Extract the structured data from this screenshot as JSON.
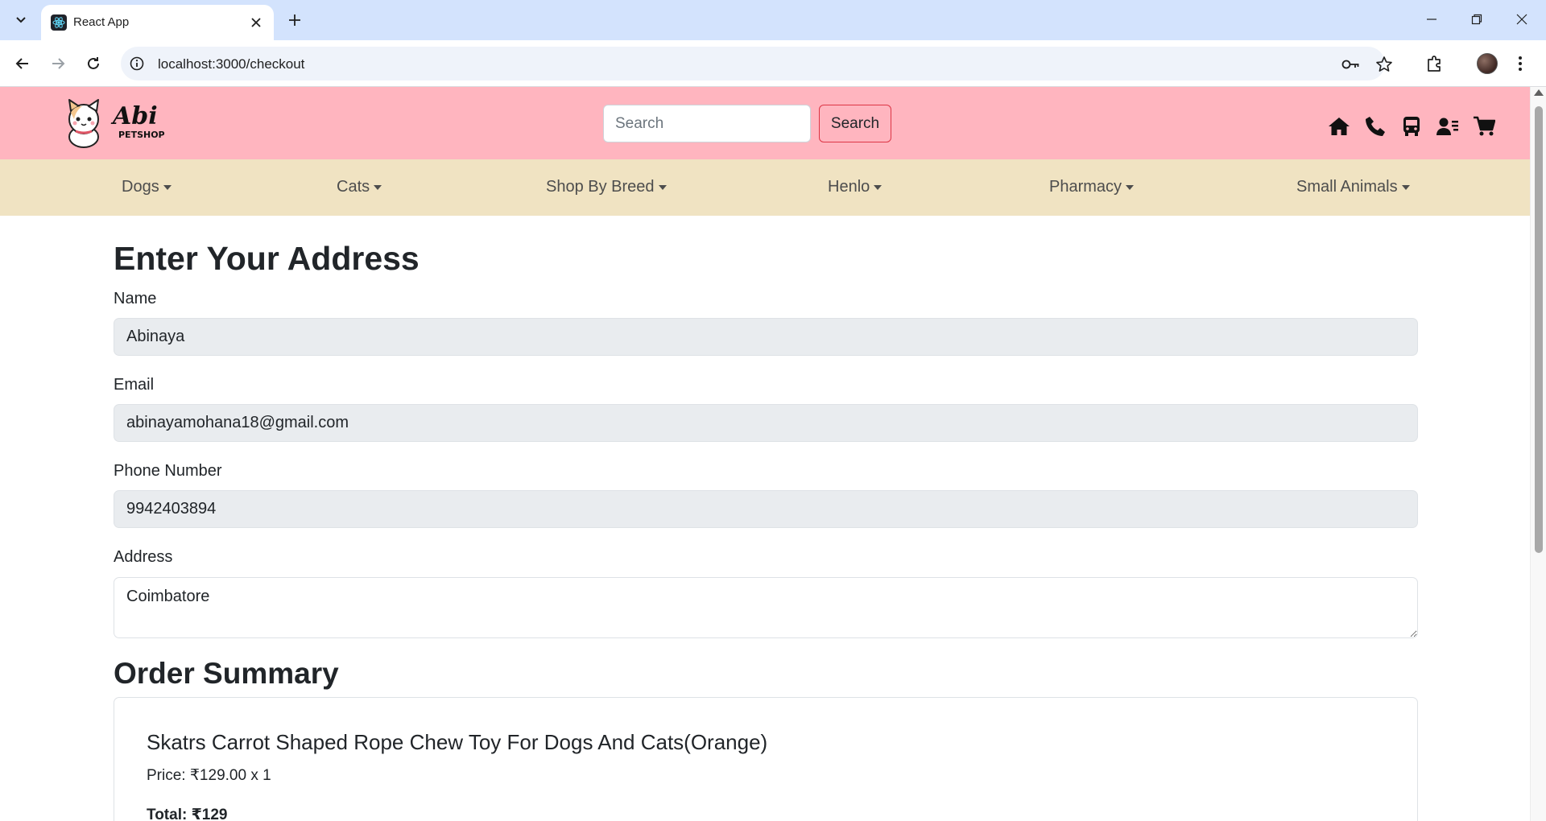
{
  "browser": {
    "tab_title": "React App",
    "url": "localhost:3000/checkout"
  },
  "header": {
    "logo_text": "Abi",
    "logo_subtext": "PETSHOP",
    "search_placeholder": "Search",
    "search_button": "Search",
    "icons": [
      "home-icon",
      "phone-icon",
      "bus-icon",
      "contact-icon",
      "cart-icon"
    ]
  },
  "nav": {
    "items": [
      "Dogs",
      "Cats",
      "Shop By Breed",
      "Henlo",
      "Pharmacy",
      "Small Animals"
    ]
  },
  "form": {
    "heading": "Enter Your Address",
    "name_label": "Name",
    "name_value": "Abinaya",
    "email_label": "Email",
    "email_value": "abinayamohana18@gmail.com",
    "phone_label": "Phone Number",
    "phone_value": "9942403894",
    "address_label": "Address",
    "address_value": "Coimbatore"
  },
  "summary": {
    "heading": "Order Summary",
    "item_name": "Skatrs Carrot Shaped Rope Chew Toy For Dogs And Cats(Orange)",
    "item_price": "Price: ₹129.00 x 1",
    "total": "Total: ₹129"
  },
  "colors": {
    "header_bg": "#ffb5bf",
    "nav_bg": "#f0e3c2",
    "search_button_border": "#dc3545"
  }
}
